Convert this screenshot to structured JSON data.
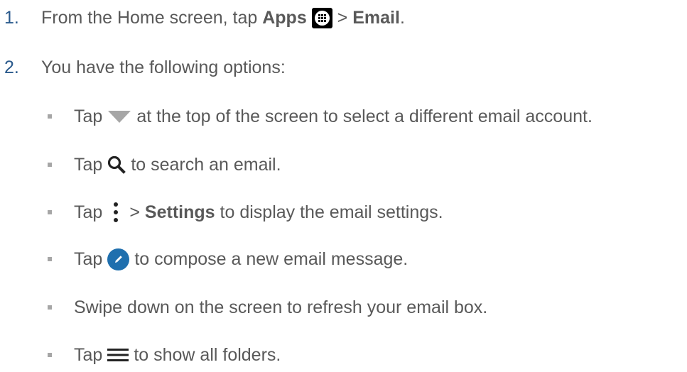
{
  "steps": [
    {
      "number": "1.",
      "prefix": "From the Home screen, tap ",
      "apps_label": "Apps",
      "separator": " > ",
      "email_label": "Email",
      "suffix": "."
    },
    {
      "number": "2.",
      "text": "You have the following options:"
    }
  ],
  "options": {
    "account": {
      "tap": "Tap",
      "text": "at the top of the screen to select a different email account.",
      "icon": "dropdown-triangle-icon"
    },
    "search": {
      "tap": "Tap",
      "text": "to search an email.",
      "icon": "search-icon"
    },
    "settings": {
      "tap": "Tap",
      "separator": ">",
      "settings_label": "Settings",
      "text": "to display the email settings.",
      "icon": "more-vert-icon"
    },
    "compose": {
      "tap": "Tap",
      "text": "to compose a new email message.",
      "icon": "compose-icon"
    },
    "refresh": {
      "text": "Swipe down on the screen to refresh your email box."
    },
    "folders": {
      "tap": "Tap",
      "text": "to show all folders.",
      "icon": "menu-icon"
    }
  },
  "colors": {
    "text": "#595959",
    "step_number": "#2a5a8c",
    "bullet": "#a6a6a6",
    "icon_gray": "#a6a6a6",
    "compose_blue": "#1f6fae"
  }
}
